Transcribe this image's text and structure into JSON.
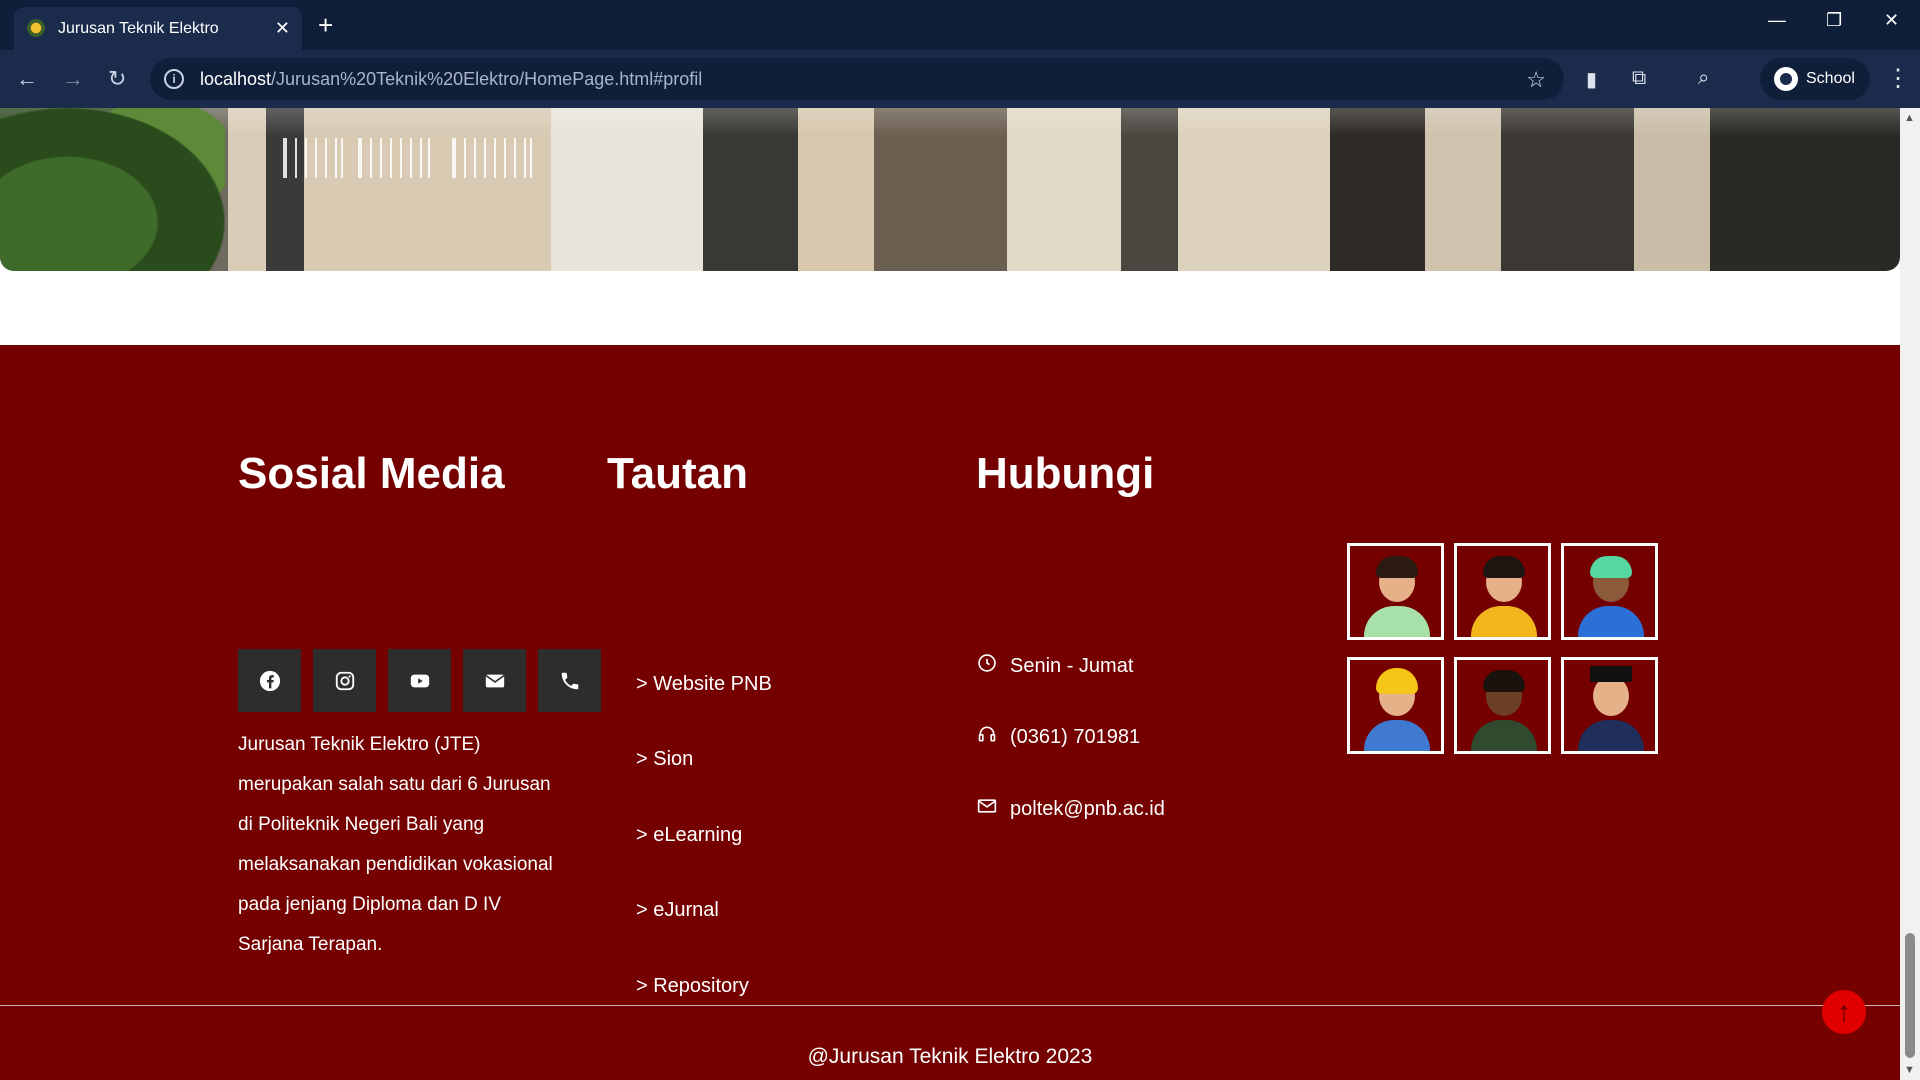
{
  "browser": {
    "tab_title": "Jurusan Teknik Elektro",
    "url_host": "localhost",
    "url_path": "/Jurusan%20Teknik%20Elektro/HomePage.html#profil",
    "profile_name": "School"
  },
  "footer": {
    "social": {
      "title": "Sosial Media",
      "icons": [
        "facebook-icon",
        "instagram-icon",
        "youtube-icon",
        "email-icon",
        "phone-icon"
      ],
      "about_lines": [
        "Jurusan Teknik Elektro (JTE)",
        "merupakan salah satu dari 6 Jurusan",
        "di Politeknik Negeri Bali yang",
        "melaksanakan pendidikan vokasional",
        "pada jenjang Diploma dan D IV",
        "Sarjana Terapan."
      ]
    },
    "links": {
      "title": "Tautan",
      "items": [
        "> Website PNB",
        "> Sion",
        "> eLearning",
        "> eJurnal",
        "> Repository"
      ]
    },
    "contact": {
      "title": "Hubungi",
      "hours": "Senin - Jumat",
      "phone": "(0361) 701981",
      "email": "poltek@pnb.ac.id"
    },
    "copyright": "@Jurusan Teknik Elektro 2023"
  },
  "colors": {
    "footer_bg": "#740000",
    "social_btn_bg": "#2d2d2d",
    "back_to_top": "#e00000",
    "browser_chrome": "#1b2b4b"
  }
}
